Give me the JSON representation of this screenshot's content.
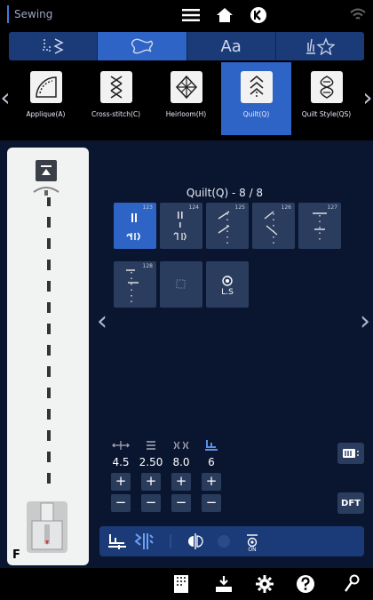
{
  "status_bar": {
    "mode_label": "Sewing"
  },
  "category_tabs": [
    {
      "name": "utility-stitches",
      "icon": "utility-stitch-icon"
    },
    {
      "name": "decorative-stitches",
      "icon": "decorative-stitch-icon",
      "active": true
    },
    {
      "name": "lettering",
      "label": "Aa"
    },
    {
      "name": "favorites",
      "icon": "favorite-star-icon"
    }
  ],
  "stitch_categories": [
    {
      "label": "Applique(A)",
      "icon": "applique-icon"
    },
    {
      "label": "Cross-stitch(C)",
      "icon": "cross-stitch-icon"
    },
    {
      "label": "Heirloom(H)",
      "icon": "heirloom-icon"
    },
    {
      "label": "Quilt(Q)",
      "icon": "quilt-icon",
      "active": true
    },
    {
      "label": "Quilt Style(QS)",
      "icon": "quilt-style-icon"
    }
  ],
  "grid": {
    "title": "Quilt(Q) - 8 / 8",
    "tiles": [
      {
        "num": "123",
        "active": true
      },
      {
        "num": "124"
      },
      {
        "num": "125"
      },
      {
        "num": "126"
      },
      {
        "num": "127"
      },
      {
        "num": "128"
      },
      {
        "num": ""
      },
      {
        "num": "",
        "label": "L.S"
      }
    ]
  },
  "settings": {
    "width": "4.5",
    "length": "2.50",
    "tension": "8.0",
    "presser_foot_pressure": "6"
  },
  "buttons": {
    "plus": "+",
    "minus": "−",
    "dft": "DFT",
    "on": "ON"
  },
  "presser_foot": {
    "letter": "F"
  },
  "colors": {
    "accent": "#2e64c5",
    "tab_bg": "#1b3b78",
    "panel_bg": "#0a1630",
    "tile_bg": "#2b3d5f"
  }
}
